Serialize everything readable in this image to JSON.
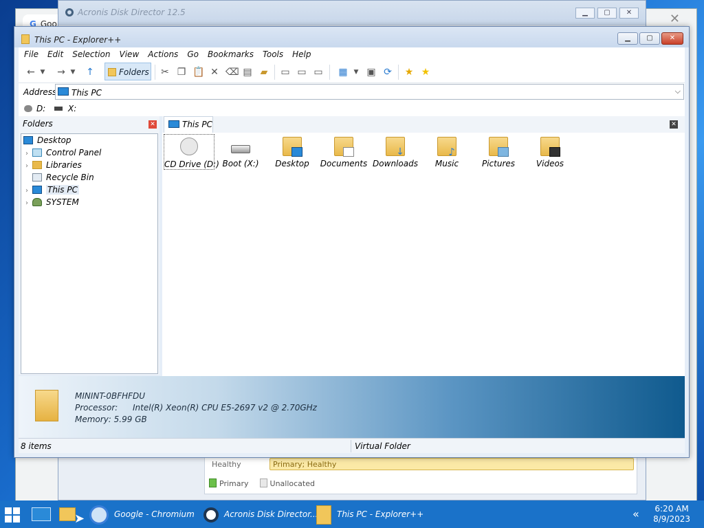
{
  "chrome": {
    "tab_title": "Goo",
    "tab_icon": "G"
  },
  "acronis": {
    "title": "Acronis Disk Director 12.5",
    "health_label": "Healthy",
    "health_value": "Primary; Healthy",
    "legend": [
      {
        "label": "Primary",
        "color": "#6cc04a"
      },
      {
        "label": "Unallocated",
        "color": "#e8e8e8"
      }
    ]
  },
  "explorer": {
    "title": "This PC - Explorer++",
    "menu": [
      "File",
      "Edit",
      "Selection",
      "View",
      "Actions",
      "Go",
      "Bookmarks",
      "Tools",
      "Help"
    ],
    "toolbar": {
      "folders_label": "Folders"
    },
    "address": {
      "label": "Address",
      "value": "This PC"
    },
    "drives": [
      {
        "label": "D:"
      },
      {
        "label": "X:"
      }
    ],
    "folders_pane": {
      "header": "Folders",
      "tree": [
        {
          "label": "Desktop",
          "icon": "desktop-icon",
          "color": "#2a8ad8"
        },
        {
          "label": "Control Panel",
          "icon": "control-panel-icon",
          "color": "#3aa0d8"
        },
        {
          "label": "Libraries",
          "icon": "libraries-icon",
          "color": "#e9b94a"
        },
        {
          "label": "Recycle Bin",
          "icon": "recycle-bin-icon",
          "color": "#cfd8e3"
        },
        {
          "label": "This PC",
          "icon": "pc-icon",
          "color": "#2a8ad8"
        },
        {
          "label": "SYSTEM",
          "icon": "user-icon",
          "color": "#6a8f4a"
        }
      ]
    },
    "tab": {
      "label": "This PC"
    },
    "items": [
      {
        "label": "CD Drive (D:)",
        "icon": "cd-drive-icon"
      },
      {
        "label": "Boot (X:)",
        "icon": "hard-drive-icon"
      },
      {
        "label": "Desktop",
        "icon": "desktop-folder-icon"
      },
      {
        "label": "Documents",
        "icon": "documents-folder-icon"
      },
      {
        "label": "Downloads",
        "icon": "downloads-folder-icon"
      },
      {
        "label": "Music",
        "icon": "music-folder-icon"
      },
      {
        "label": "Pictures",
        "icon": "pictures-folder-icon"
      },
      {
        "label": "Videos",
        "icon": "videos-folder-icon"
      }
    ],
    "info": {
      "computer_name": "MININT-0BFHFDU",
      "processor_label": "Processor:",
      "processor_value": "Intel(R) Xeon(R) CPU E5-2697 v2 @ 2.70GHz",
      "memory": "Memory: 5.99 GB"
    },
    "status": {
      "items": "8 items",
      "type": "Virtual Folder"
    }
  },
  "taskbar": {
    "buttons": [
      {
        "label": "Google - Chromium"
      },
      {
        "label": "Acronis Disk Director..."
      },
      {
        "label": "This PC - Explorer++"
      }
    ],
    "time": "6:20 AM",
    "date": "8/9/2023"
  }
}
